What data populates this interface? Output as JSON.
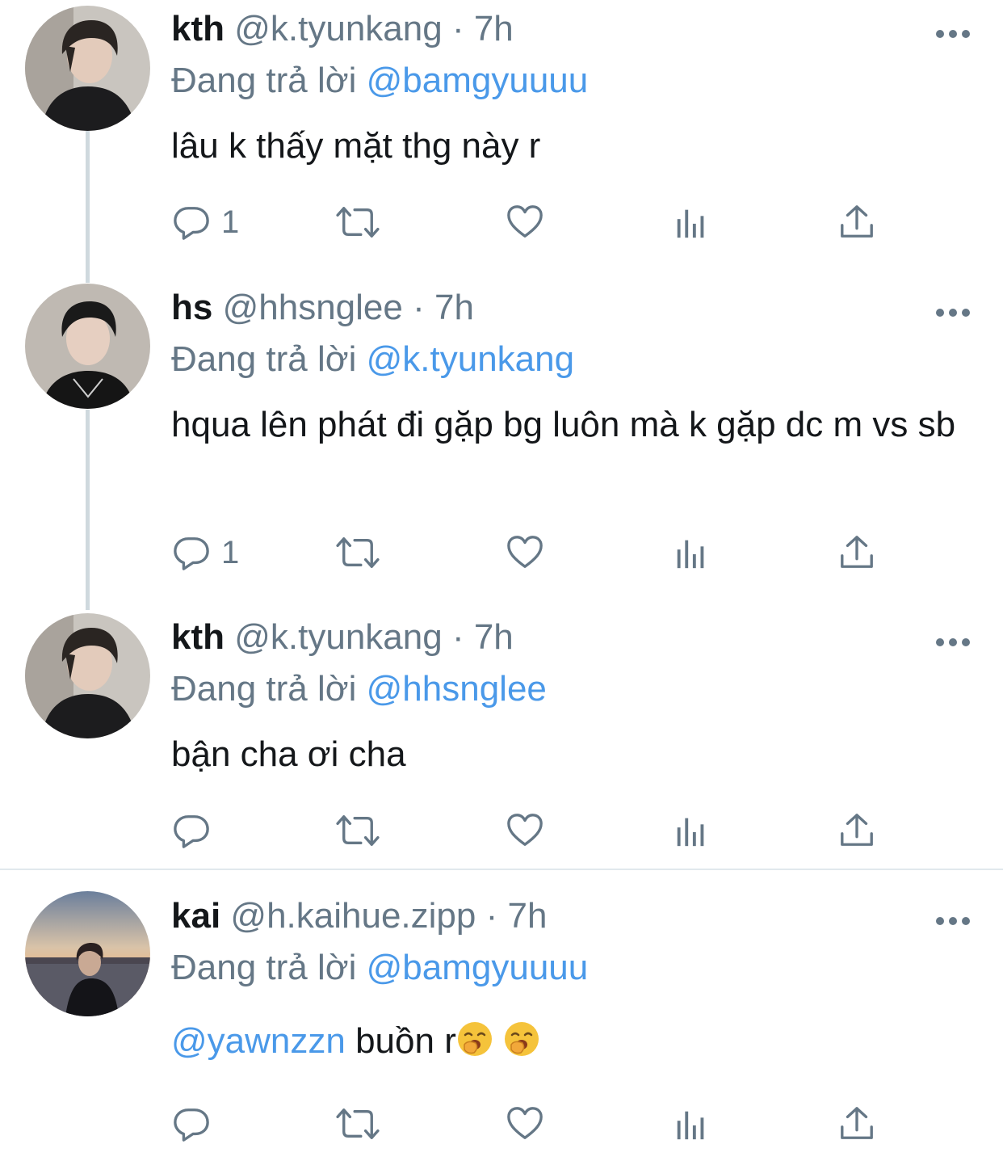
{
  "tweets": [
    {
      "name": "kth",
      "handle": "@k.tyunkang",
      "separator": "·",
      "time": "7h",
      "reply_prefix": "Đang trả lời",
      "reply_to": "@bamgyuuuu",
      "text": "lâu k thấy mặt thg này r",
      "reply_count": "1",
      "avatar": "kth-avatar"
    },
    {
      "name": "hs",
      "handle": "@hhsnglee",
      "separator": "·",
      "time": "7h",
      "reply_prefix": "Đang trả lời",
      "reply_to": "@k.tyunkang",
      "text": "hqua lên phát đi gặp bg luôn mà k gặp dc m vs sb",
      "reply_count": "1",
      "avatar": "hs-avatar"
    },
    {
      "name": "kth",
      "handle": "@k.tyunkang",
      "separator": "·",
      "time": "7h",
      "reply_prefix": "Đang trả lời",
      "reply_to": "@hhsnglee",
      "text": "bận cha ơi cha",
      "reply_count": "",
      "avatar": "kth-avatar"
    },
    {
      "name": "kai",
      "handle": "@h.kaihue.zipp",
      "separator": "·",
      "time": "7h",
      "reply_prefix": "Đang trả lời",
      "reply_to": "@bamgyuuuu",
      "text_mention": "@yawnzzn",
      "text": " buồn r",
      "emoji": "yawning-face",
      "reply_count": "",
      "avatar": "kai-avatar"
    }
  ],
  "colors": {
    "text": "#14171a",
    "secondary": "#657786",
    "link": "#4a99e9",
    "thread_line": "#cfd9de",
    "divider": "#e1e8ed"
  },
  "icons": [
    "reply-icon",
    "retweet-icon",
    "like-icon",
    "analytics-icon",
    "share-icon",
    "more-icon"
  ]
}
